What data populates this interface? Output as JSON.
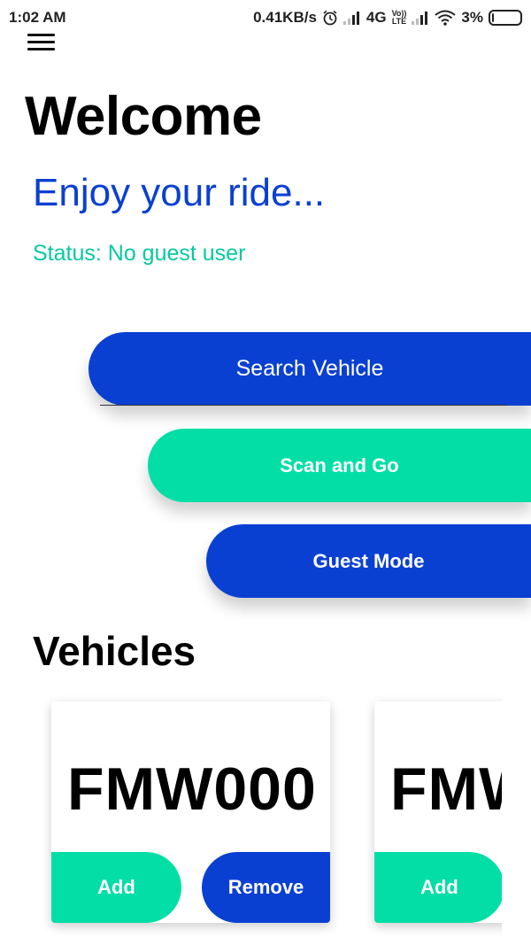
{
  "status_bar": {
    "time": "1:02 AM",
    "network_speed": "0.41KB/s",
    "network_type": "4G",
    "volte_top": "Vo))",
    "volte_bottom": "LTE",
    "battery": "3%"
  },
  "header": {
    "menu_icon": "hamburger-menu-icon",
    "title": "Welcome",
    "subtitle": "Enjoy your ride...",
    "status": "Status: No guest user"
  },
  "actions": {
    "search_vehicle": "Search Vehicle",
    "scan_and_go": "Scan and Go",
    "guest_mode": "Guest Mode"
  },
  "vehicles": {
    "title": "Vehicles",
    "items": [
      {
        "plate": "FMW000",
        "add_label": "Add",
        "remove_label": "Remove"
      },
      {
        "plate": "FMW",
        "add_label": "Add"
      }
    ]
  },
  "colors": {
    "primary_blue": "#0a40d2",
    "accent_green": "#02dea6",
    "status_green": "#06c9a0"
  }
}
